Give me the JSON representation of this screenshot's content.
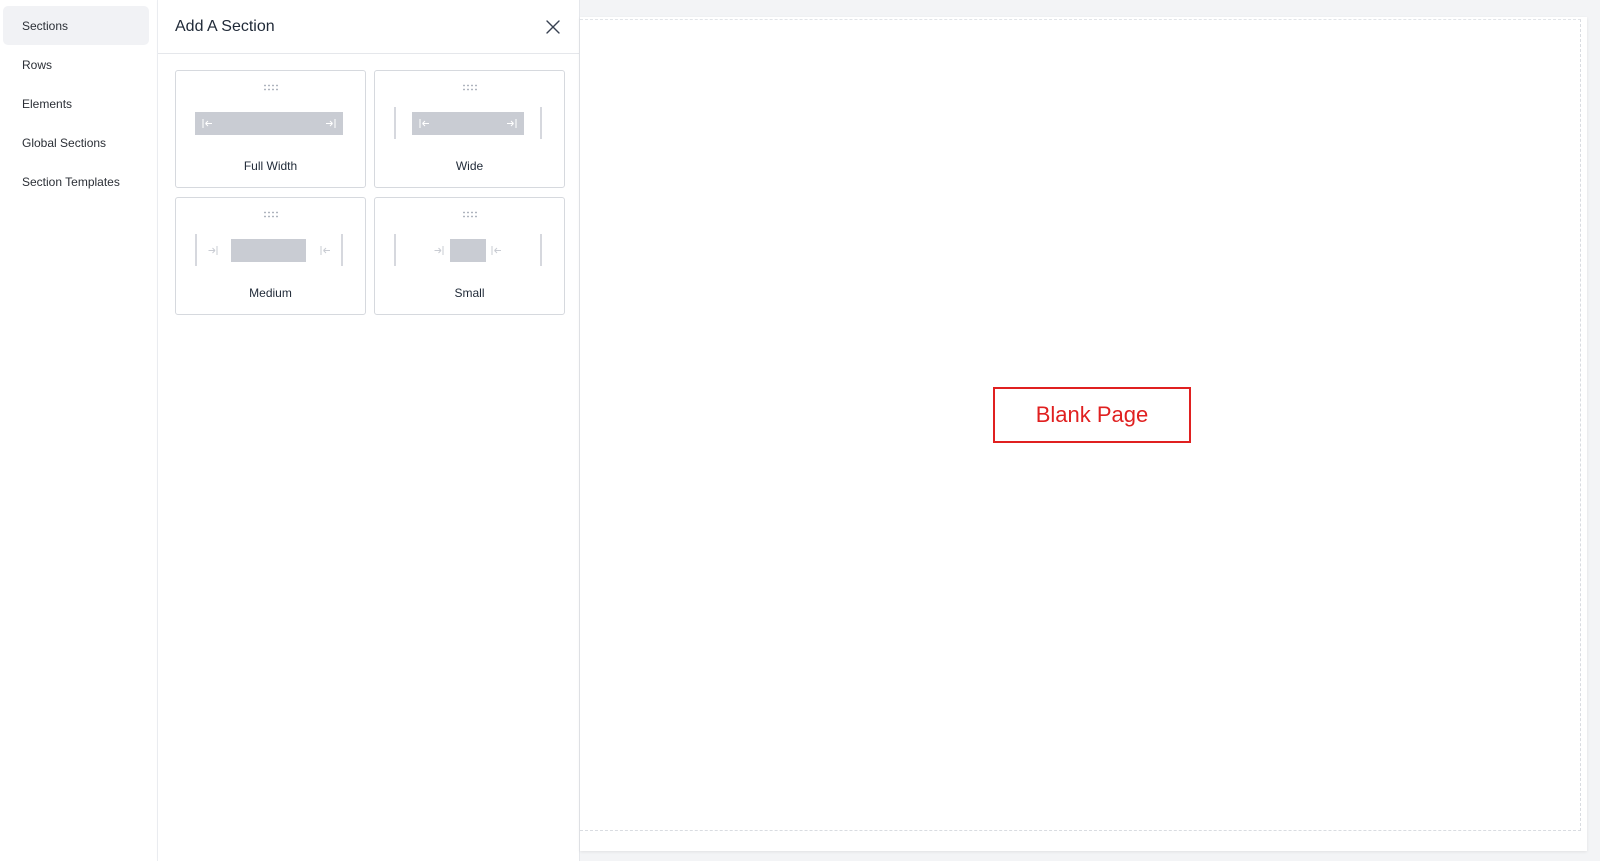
{
  "sidebar": {
    "items": [
      {
        "label": "Sections",
        "active": true
      },
      {
        "label": "Rows"
      },
      {
        "label": "Elements"
      },
      {
        "label": "Global Sections"
      },
      {
        "label": "Section Templates"
      }
    ]
  },
  "panel": {
    "title": "Add A Section",
    "close_icon": "close-icon",
    "cards": [
      {
        "label": "Full Width",
        "icon": "full-width-layout-icon"
      },
      {
        "label": "Wide",
        "icon": "wide-layout-icon"
      },
      {
        "label": "Medium",
        "icon": "medium-layout-icon"
      },
      {
        "label": "Small",
        "icon": "small-layout-icon"
      }
    ]
  },
  "canvas": {
    "placeholder_text": "Blank Page"
  },
  "colors": {
    "accent_red": "#e02020",
    "diagram_gray": "#c9ccd3",
    "active_nav_bg": "#f1f2f5"
  }
}
